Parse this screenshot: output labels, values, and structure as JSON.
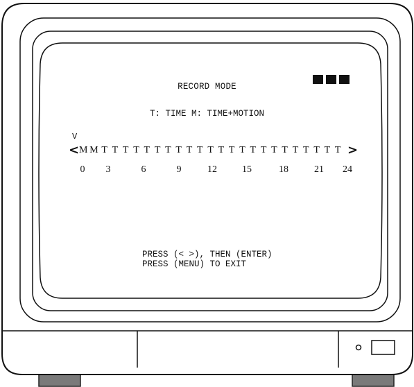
{
  "screen": {
    "title": "RECORD MODE",
    "legend": "T: TIME   M: TIME+MOTION",
    "cursor": "V",
    "left_arrow": "<",
    "right_arrow": ">",
    "schedule_slots": [
      "M",
      "M",
      "T",
      "T",
      "T",
      "T",
      "T",
      "T",
      "T",
      "T",
      "T",
      "T",
      "T",
      "T",
      "T",
      "T",
      "T",
      "T",
      "T",
      "T",
      "T",
      "T",
      "T",
      "T",
      "T"
    ],
    "hour_labels": [
      "0",
      "3",
      "6",
      "9",
      "12",
      "15",
      "18",
      "21",
      "24"
    ],
    "instructions": [
      "PRESS (< >), THEN (ENTER)",
      "PRESS (MENU) TO EXIT"
    ]
  }
}
